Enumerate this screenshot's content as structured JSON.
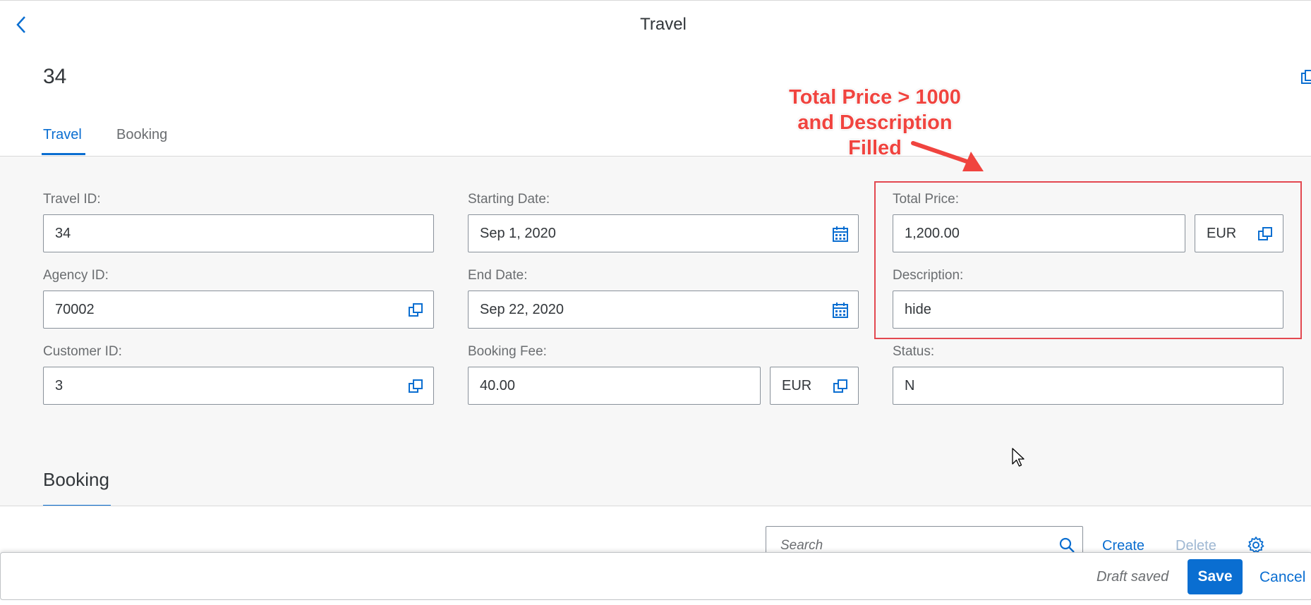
{
  "shell": {
    "title": "Travel"
  },
  "header": {
    "object_title": "34",
    "tabs": [
      {
        "label": "Travel"
      },
      {
        "label": "Booking"
      }
    ]
  },
  "form": {
    "travel_id": {
      "label": "Travel ID:",
      "value": "34"
    },
    "agency_id": {
      "label": "Agency ID:",
      "value": "70002"
    },
    "customer_id": {
      "label": "Customer ID:",
      "value": "3"
    },
    "starting_date": {
      "label": "Starting Date:",
      "value": "Sep 1, 2020"
    },
    "end_date": {
      "label": "End Date:",
      "value": "Sep 22, 2020"
    },
    "booking_fee": {
      "label": "Booking Fee:",
      "value": "40.00",
      "currency": "EUR"
    },
    "total_price": {
      "label": "Total Price:",
      "value": "1,200.00",
      "currency": "EUR"
    },
    "description": {
      "label": "Description:",
      "value": "hide"
    },
    "status": {
      "label": "Status:",
      "value": "N"
    }
  },
  "annotation": {
    "lines": [
      "Total Price > 1000",
      "and Description",
      "Filled"
    ],
    "color": "#e34850"
  },
  "booking_section": {
    "title": "Booking",
    "search_placeholder": "Search",
    "create_label": "Create",
    "delete_label": "Delete"
  },
  "footer": {
    "draft_status": "Draft saved",
    "save_label": "Save",
    "cancel_label": "Cancel"
  },
  "colors": {
    "accent": "#0a6ed1",
    "annotation": "#e34850"
  }
}
